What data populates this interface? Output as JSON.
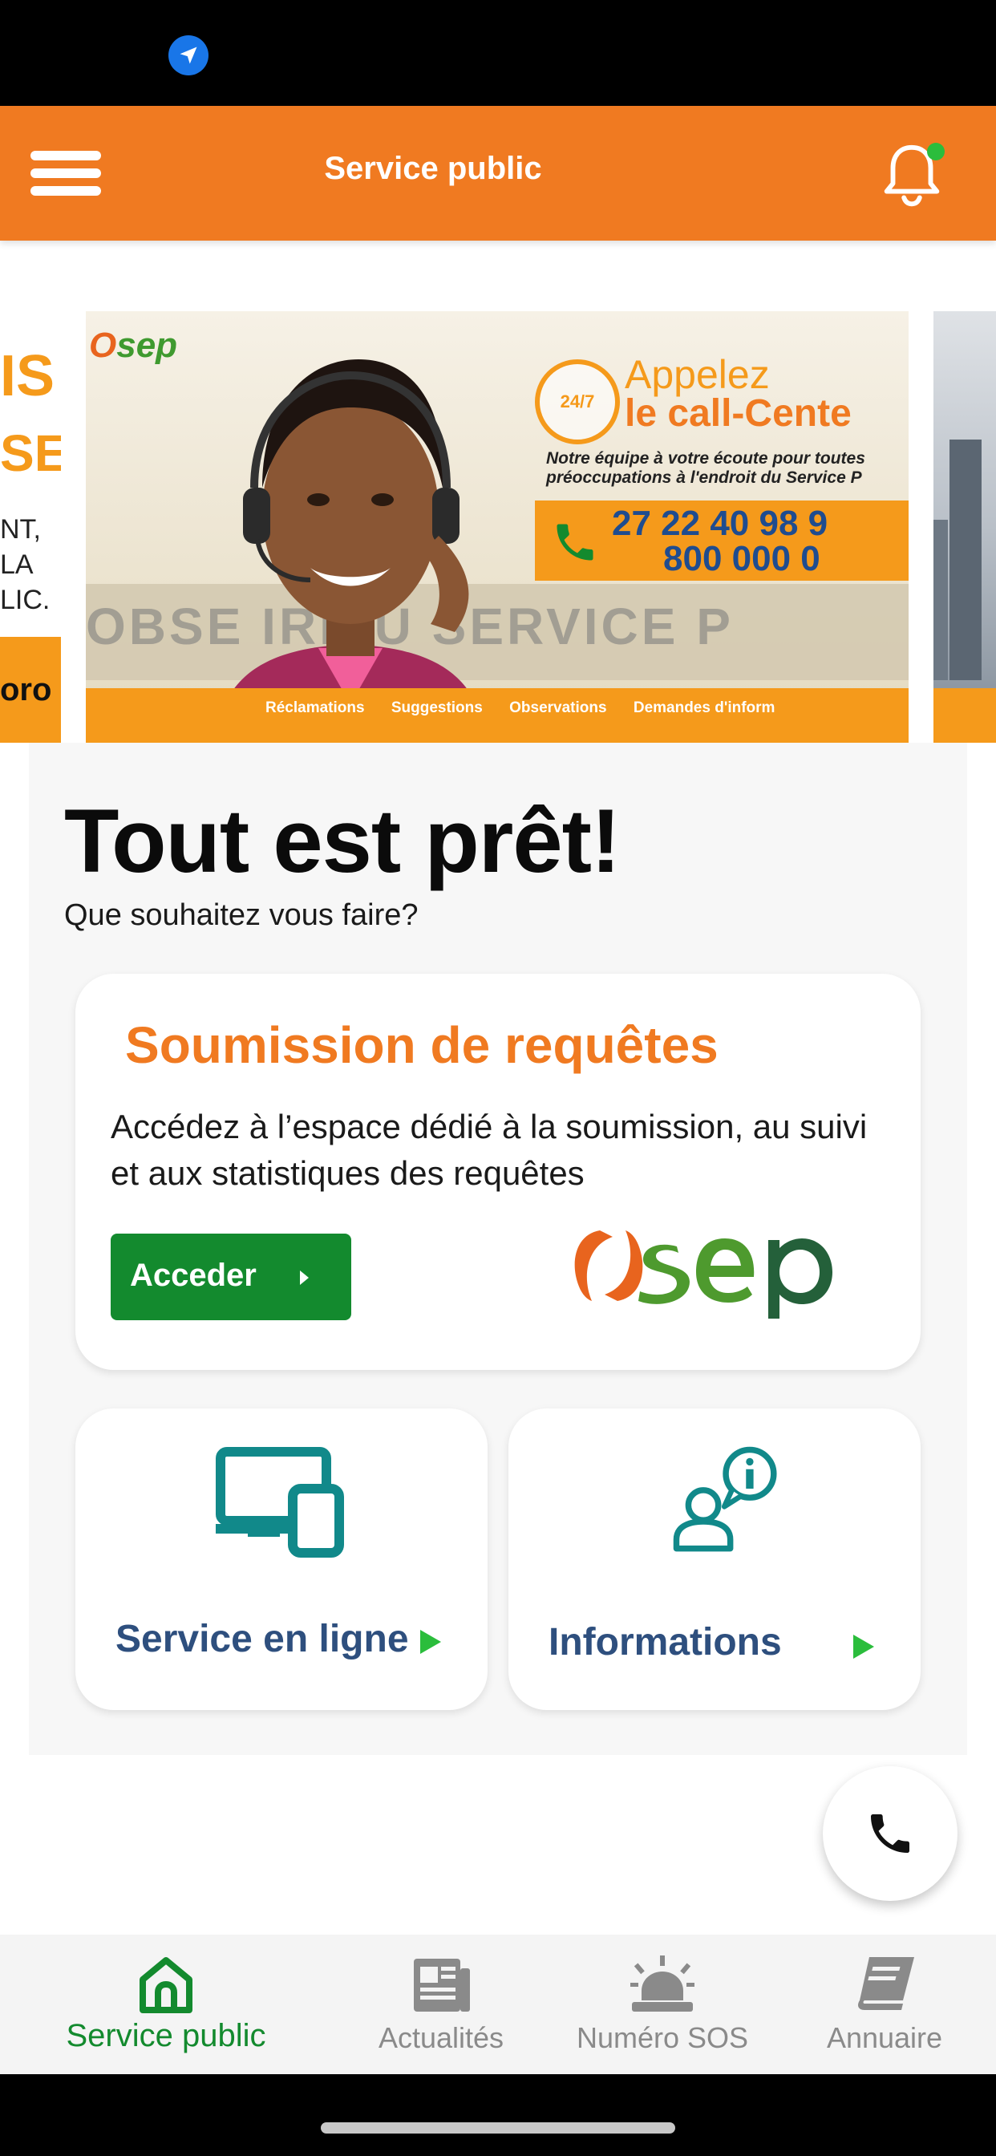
{
  "app_bar": {
    "title": "Service public"
  },
  "banner": {
    "left_slide": {
      "line1": "IS",
      "line2": "SE",
      "line3": "NT,",
      "line4": "LA",
      "line5": "LIC.",
      "line6": "oro"
    },
    "main_slide": {
      "badge": "24/7",
      "headline1": "Appelez",
      "headline2": "le call-Cente",
      "description": "Notre équipe à votre écoute pour toutes préoccupations à l'endroit du Service P",
      "phone1": "27 22 40 98 9",
      "phone2": "800 000 0",
      "background_text": "OBSE    IRE  U SERVICE P",
      "bullets": [
        "Réclamations",
        "Suggestions",
        "Observations",
        "Demandes d'inform"
      ]
    }
  },
  "main": {
    "headline": "Tout est prêt!",
    "subline": "Que souhaitez vous faire?",
    "requests_card": {
      "title": "Soumission de requêtes",
      "description": " Accédez à l’espace dédié à la soumission, au suivi et aux statistiques des requêtes",
      "button_label": "Acceder"
    },
    "online_service_card": {
      "label": "Service en ligne",
      "icon": "devices-icon"
    },
    "info_card": {
      "label": "Informations",
      "icon": "user-info-icon"
    }
  },
  "bottom_nav": {
    "items": [
      {
        "label": "Service public",
        "icon": "home-icon",
        "active": true
      },
      {
        "label": "Actualités",
        "icon": "newspaper-icon",
        "active": false
      },
      {
        "label": "Numéro SOS",
        "icon": "siren-icon",
        "active": false
      },
      {
        "label": "Annuaire",
        "icon": "book-icon",
        "active": false
      }
    ]
  },
  "colors": {
    "brand_orange": "#f07a21",
    "action_green": "#138a2e",
    "label_blue": "#2e4f7e",
    "icon_teal": "#11898a",
    "accent_green": "#2bbd3c"
  }
}
